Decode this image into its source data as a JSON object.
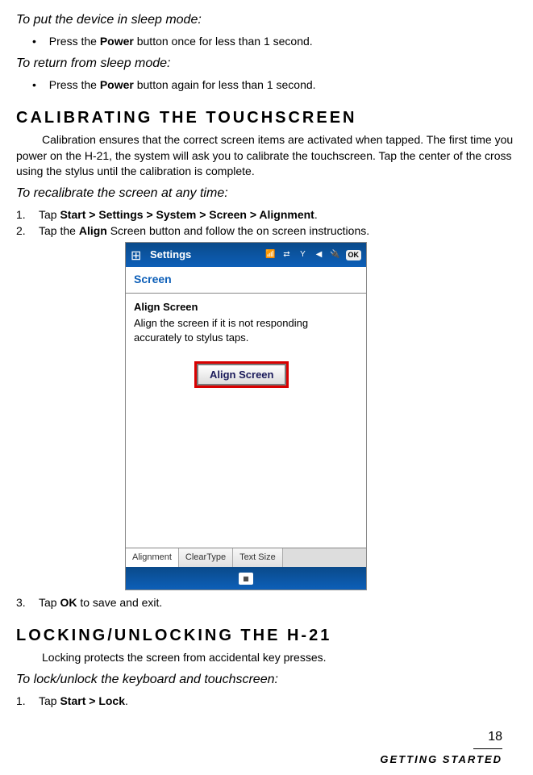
{
  "sleep": {
    "heading": "To put the device in sleep mode:",
    "bullet": "Press the ",
    "bold": "Power",
    "bullet_end": " button once for less than 1 second."
  },
  "return": {
    "heading": "To return from sleep mode:",
    "bullet": "Press the ",
    "bold": "Power",
    "bullet_end": " button again for less than 1 second."
  },
  "calibrating": {
    "title": "Calibrating the Touchscreen",
    "para": "Calibration ensures that the correct screen items are activated when tapped. The first time you power on the H-21, the system will ask you to calibrate the touchscreen. Tap the center of the cross using the stylus until the calibration is complete.",
    "sub": "To recalibrate the screen at any time:",
    "step1_pre": "Tap ",
    "step1_bold": "Start > Settings > System > Screen > Alignment",
    "step1_post": ".",
    "step2_pre": "Tap the ",
    "step2_bold": "Align",
    "step2_post": " Screen button and follow the on screen instructions.",
    "step3_pre": "Tap ",
    "step3_bold": "OK",
    "step3_post": " to save and exit."
  },
  "screenshot": {
    "titlebar": "Settings",
    "ok": "OK",
    "screen_label": "Screen",
    "align_title": "Align Screen",
    "align_desc": "Align the screen if it is not responding accurately to stylus taps.",
    "button": "Align Screen",
    "tabs": {
      "alignment": "Alignment",
      "cleartype": "ClearType",
      "textsize": "Text Size"
    },
    "kbd": "⌨"
  },
  "locking": {
    "title": "Locking/Unlocking the H-21",
    "para": "Locking protects the screen from accidental key presses.",
    "sub": "To lock/unlock the keyboard and touchscreen:",
    "step1_pre": "Tap ",
    "step1_bold": "Start > Lock",
    "step1_post": "."
  },
  "footer": {
    "page": "18",
    "label": "Getting Started"
  }
}
